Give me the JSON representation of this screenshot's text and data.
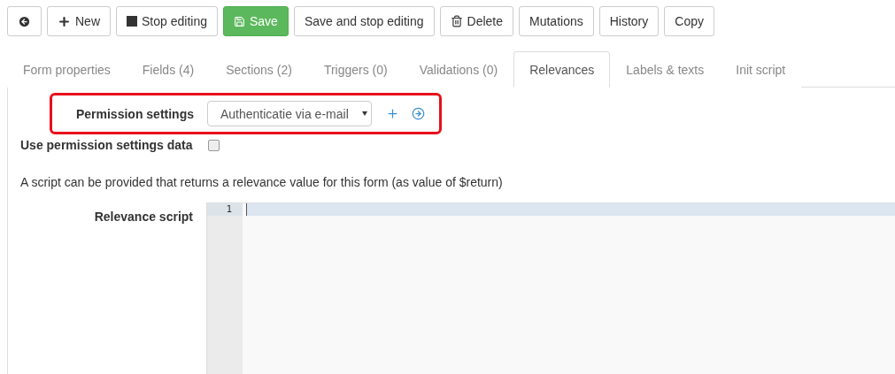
{
  "toolbar": [
    {
      "kind": "back"
    },
    {
      "kind": "add",
      "label": "New"
    },
    {
      "kind": "stop",
      "label": "Stop editing"
    },
    {
      "kind": "save",
      "label": "Save"
    },
    {
      "kind": "plain",
      "label": "Save and stop editing"
    },
    {
      "kind": "delete",
      "label": "Delete"
    },
    {
      "kind": "plain",
      "label": "Mutations"
    },
    {
      "kind": "plain",
      "label": "History"
    },
    {
      "kind": "plain",
      "label": "Copy"
    }
  ],
  "tabs": [
    {
      "label": "Form properties",
      "selected": false
    },
    {
      "label": "Fields (4)",
      "selected": false
    },
    {
      "label": "Sections (2)",
      "selected": false
    },
    {
      "label": "Triggers (0)",
      "selected": false
    },
    {
      "label": "Validations (0)",
      "selected": false
    },
    {
      "label": "Relevances",
      "selected": true
    },
    {
      "label": "Labels & texts",
      "selected": false
    },
    {
      "label": "Init script",
      "selected": false
    }
  ],
  "permission": {
    "label": "Permission settings",
    "value": "Authenticatie via e-mail",
    "highlighted": true
  },
  "use_data": {
    "label": "Use permission settings data",
    "checked": false
  },
  "description": "A script can be provided that returns a relevance value for this form (as value of $return)",
  "script": {
    "label": "Relevance script",
    "line_numbers": [
      "1"
    ]
  }
}
